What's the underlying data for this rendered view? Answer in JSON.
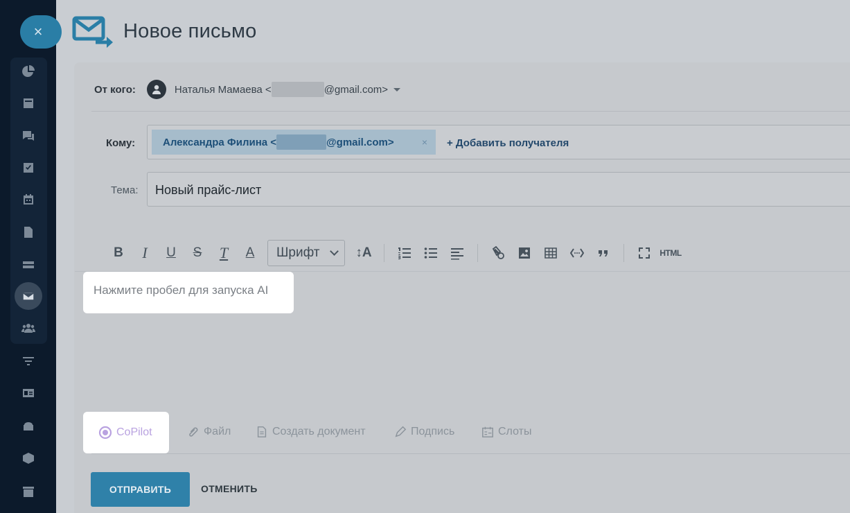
{
  "window": {
    "title": "Новое письмо",
    "close_glyph": "×"
  },
  "rail": {
    "icons": [
      "pie-chart-icon",
      "news-icon",
      "chat-icon",
      "task-icon",
      "calendar-icon",
      "document-icon",
      "drive-icon",
      "mail-icon",
      "group-icon",
      "filter-icon",
      "contact-card-icon",
      "robot-icon",
      "box-icon",
      "store-icon"
    ],
    "active": "mail-icon"
  },
  "from": {
    "label": "От кого:",
    "name_prefix": "Наталья Мамаева <",
    "email_suffix": "@gmail.com>"
  },
  "to": {
    "label": "Кому:",
    "recipient_prefix": "Александра Филина <",
    "recipient_suffix": "@gmail.com>",
    "remove_glyph": "×",
    "add_label": "+ Добавить получателя"
  },
  "subject": {
    "label": "Тема:",
    "value": "Новый прайс-лист"
  },
  "toolbar": {
    "bold": "B",
    "italic": "I",
    "underline": "U",
    "strike": "S",
    "clear_format": "T",
    "color": "A",
    "font_select": "Шрифт",
    "font_size": "↕A",
    "html": "HTML"
  },
  "editor": {
    "placeholder": "Нажмите пробел для запуска AI"
  },
  "bottom": {
    "copilot": "CoPilot",
    "file": "Файл",
    "create_doc": "Создать документ",
    "signature": "Подпись",
    "slots": "Слоты"
  },
  "actions": {
    "send": "ОТПРАВИТЬ",
    "cancel": "ОТМЕНИТЬ"
  },
  "colors": {
    "accent": "#2f81a9",
    "copilot": "#b9a2e0",
    "rail": "#0c1a2b"
  }
}
